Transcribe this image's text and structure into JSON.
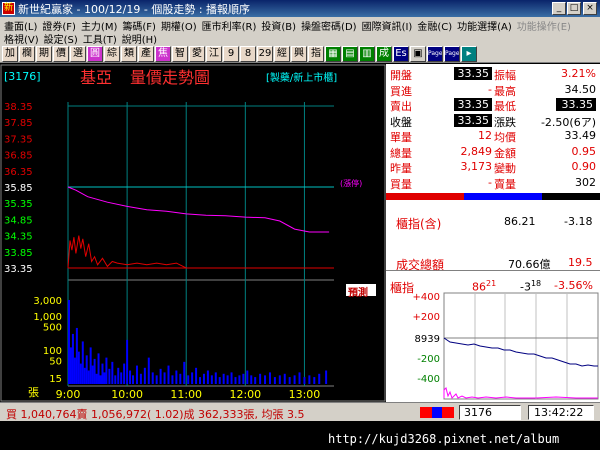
{
  "window": {
    "title": "新世紀贏家 - 100/12/19 - 個股走勢 : 播報順序",
    "app_icon": "app-icon",
    "buttons": {
      "min": "_",
      "max": "□",
      "close": "×"
    }
  },
  "menu": {
    "row1": [
      "畫面(L)",
      "證券(F)",
      "主力(M)",
      "籌碼(F)",
      "期權(O)",
      "匯市利率(R)",
      "投資(B)",
      "操盤密碼(D)",
      "國際資訊(I)",
      "金融(C)",
      "功能選擇(A)",
      "功能操作(E)"
    ],
    "row2": [
      "格視(V)",
      "設定(S)",
      "工具(T)",
      "說明(H)"
    ]
  },
  "toolbar": {
    "items": [
      {
        "label": "加",
        "bg": "#e8d8c8",
        "fg": "#000"
      },
      {
        "label": "欄",
        "bg": "#e8d8c8",
        "fg": "#000"
      },
      {
        "label": "期",
        "bg": "#e8d8c8",
        "fg": "#000"
      },
      {
        "label": "價",
        "bg": "#e8d8c8",
        "fg": "#000"
      },
      {
        "label": "選",
        "bg": "#e8d8c8",
        "fg": "#000"
      },
      {
        "label": "圓",
        "bg": "#cc33cc",
        "fg": "#fff"
      },
      {
        "label": "綜",
        "bg": "#e8d8c8",
        "fg": "#000"
      },
      {
        "label": "類",
        "bg": "#e8d8c8",
        "fg": "#000"
      },
      {
        "label": "產",
        "bg": "#e8d8c8",
        "fg": "#000"
      },
      {
        "label": "焦",
        "bg": "#cc33cc",
        "fg": "#fff"
      },
      {
        "label": "智",
        "bg": "#e8d8c8",
        "fg": "#000"
      },
      {
        "label": "愛",
        "bg": "#e8d8c8",
        "fg": "#000"
      },
      {
        "label": "江",
        "bg": "#e8d8c8",
        "fg": "#000"
      },
      {
        "label": "9",
        "bg": "#e8d8c8",
        "fg": "#000"
      },
      {
        "label": "8",
        "bg": "#e8d8c8",
        "fg": "#000"
      },
      {
        "label": "29",
        "bg": "#e8d8c8",
        "fg": "#000"
      },
      {
        "label": "經",
        "bg": "#e8d8c8",
        "fg": "#000"
      },
      {
        "label": "興",
        "bg": "#e8d8c8",
        "fg": "#000"
      },
      {
        "label": "指",
        "bg": "#e8d8c8",
        "fg": "#000"
      },
      {
        "label": "▦",
        "bg": "#008000",
        "fg": "#fff"
      },
      {
        "label": "▤",
        "bg": "#008000",
        "fg": "#fff"
      },
      {
        "label": "▥",
        "bg": "#008000",
        "fg": "#fff"
      },
      {
        "label": "成",
        "bg": "#008000",
        "fg": "#fff"
      },
      {
        "label": "Es",
        "bg": "#000080",
        "fg": "#fff"
      },
      {
        "label": "▣",
        "bg": "#d4d0c8",
        "fg": "#000"
      },
      {
        "label": "Page",
        "bg": "#000080",
        "fg": "#fff"
      },
      {
        "label": "Page",
        "bg": "#000080",
        "fg": "#fff"
      },
      {
        "label": "▸",
        "bg": "#008080",
        "fg": "#fff"
      }
    ]
  },
  "chart": {
    "code": "[3176]",
    "name": "基亞",
    "view_title": "量價走勢圖",
    "market": "[製藥/新上市櫃]",
    "limit_up_tag": "(漲停)",
    "limit_down_tag": "預測",
    "unit_label": "張",
    "chart_data": {
      "type": "line",
      "price_ticks": [
        "38.35",
        "37.85",
        "37.35",
        "36.85",
        "36.35",
        "35.85",
        "35.35",
        "34.85",
        "34.35",
        "33.85",
        "33.35"
      ],
      "price_range": [
        33.35,
        38.35
      ],
      "reference_price": 35.85,
      "low_line": 33.35,
      "volume_ticks": [
        "3,000",
        "1,000",
        "500",
        "100",
        "50",
        "15"
      ],
      "time_ticks": [
        "9:00",
        "10:00",
        "11:00",
        "12:00",
        "13:00"
      ],
      "avg_series": [
        {
          "t": 0,
          "p": 35.85
        },
        {
          "t": 8,
          "p": 35.75
        },
        {
          "t": 20,
          "p": 35.55
        },
        {
          "t": 40,
          "p": 35.38
        },
        {
          "t": 60,
          "p": 35.25
        },
        {
          "t": 80,
          "p": 35.15
        },
        {
          "t": 100,
          "p": 35.1
        },
        {
          "t": 120,
          "p": 35.02
        },
        {
          "t": 140,
          "p": 34.98
        },
        {
          "t": 160,
          "p": 34.96
        },
        {
          "t": 180,
          "p": 34.92
        },
        {
          "t": 200,
          "p": 34.9
        },
        {
          "t": 215,
          "p": 34.8
        },
        {
          "t": 230,
          "p": 34.55
        },
        {
          "t": 245,
          "p": 34.46
        },
        {
          "t": 265,
          "p": 34.46
        }
      ],
      "price_series": [
        {
          "t": 0,
          "p": 33.35
        },
        {
          "t": 2,
          "p": 34.2
        },
        {
          "t": 4,
          "p": 33.9
        },
        {
          "t": 6,
          "p": 34.3
        },
        {
          "t": 8,
          "p": 33.8
        },
        {
          "t": 11,
          "p": 34.35
        },
        {
          "t": 13,
          "p": 33.95
        },
        {
          "t": 15,
          "p": 34.25
        },
        {
          "t": 18,
          "p": 33.7
        },
        {
          "t": 21,
          "p": 34.1
        },
        {
          "t": 24,
          "p": 33.55
        },
        {
          "t": 27,
          "p": 33.7
        },
        {
          "t": 30,
          "p": 33.45
        },
        {
          "t": 35,
          "p": 33.65
        },
        {
          "t": 40,
          "p": 33.4
        },
        {
          "t": 45,
          "p": 33.55
        },
        {
          "t": 50,
          "p": 33.5
        },
        {
          "t": 60,
          "p": 33.45
        },
        {
          "t": 70,
          "p": 33.5
        },
        {
          "t": 80,
          "p": 33.45
        },
        {
          "t": 90,
          "p": 33.5
        },
        {
          "t": 100,
          "p": 33.45
        },
        {
          "t": 110,
          "p": 33.5
        },
        {
          "t": 120,
          "p": 33.35
        },
        {
          "t": 140,
          "p": 33.35
        },
        {
          "t": 160,
          "p": 33.35
        },
        {
          "t": 185,
          "p": 33.35
        }
      ],
      "volume_series": [
        {
          "t": 1,
          "v": 3000
        },
        {
          "t": 3,
          "v": 120
        },
        {
          "t": 5,
          "v": 300
        },
        {
          "t": 7,
          "v": 60
        },
        {
          "t": 9,
          "v": 450
        },
        {
          "t": 11,
          "v": 90
        },
        {
          "t": 13,
          "v": 40
        },
        {
          "t": 15,
          "v": 180
        },
        {
          "t": 17,
          "v": 30
        },
        {
          "t": 19,
          "v": 70
        },
        {
          "t": 21,
          "v": 25
        },
        {
          "t": 23,
          "v": 120
        },
        {
          "t": 25,
          "v": 35
        },
        {
          "t": 27,
          "v": 55
        },
        {
          "t": 29,
          "v": 20
        },
        {
          "t": 31,
          "v": 80
        },
        {
          "t": 33,
          "v": 18
        },
        {
          "t": 35,
          "v": 40
        },
        {
          "t": 37,
          "v": 22
        },
        {
          "t": 39,
          "v": 60
        },
        {
          "t": 42,
          "v": 28
        },
        {
          "t": 45,
          "v": 45
        },
        {
          "t": 48,
          "v": 18
        },
        {
          "t": 51,
          "v": 30
        },
        {
          "t": 54,
          "v": 22
        },
        {
          "t": 57,
          "v": 40
        },
        {
          "t": 60,
          "v": 200
        },
        {
          "t": 63,
          "v": 25
        },
        {
          "t": 66,
          "v": 18
        },
        {
          "t": 70,
          "v": 35
        },
        {
          "t": 74,
          "v": 20
        },
        {
          "t": 78,
          "v": 30
        },
        {
          "t": 82,
          "v": 60
        },
        {
          "t": 86,
          "v": 22
        },
        {
          "t": 90,
          "v": 18
        },
        {
          "t": 94,
          "v": 28
        },
        {
          "t": 98,
          "v": 22
        },
        {
          "t": 102,
          "v": 35
        },
        {
          "t": 106,
          "v": 18
        },
        {
          "t": 110,
          "v": 25
        },
        {
          "t": 114,
          "v": 20
        },
        {
          "t": 118,
          "v": 45
        },
        {
          "t": 122,
          "v": 18
        },
        {
          "t": 126,
          "v": 22
        },
        {
          "t": 130,
          "v": 30
        },
        {
          "t": 134,
          "v": 16
        },
        {
          "t": 138,
          "v": 20
        },
        {
          "t": 142,
          "v": 25
        },
        {
          "t": 146,
          "v": 18
        },
        {
          "t": 150,
          "v": 22
        },
        {
          "t": 154,
          "v": 16
        },
        {
          "t": 158,
          "v": 20
        },
        {
          "t": 162,
          "v": 18
        },
        {
          "t": 166,
          "v": 22
        },
        {
          "t": 170,
          "v": 16
        },
        {
          "t": 174,
          "v": 18
        },
        {
          "t": 178,
          "v": 20
        },
        {
          "t": 182,
          "v": 25
        },
        {
          "t": 186,
          "v": 18
        },
        {
          "t": 190,
          "v": 16
        },
        {
          "t": 195,
          "v": 20
        },
        {
          "t": 200,
          "v": 18
        },
        {
          "t": 205,
          "v": 22
        },
        {
          "t": 210,
          "v": 16
        },
        {
          "t": 215,
          "v": 18
        },
        {
          "t": 220,
          "v": 20
        },
        {
          "t": 225,
          "v": 16
        },
        {
          "t": 230,
          "v": 18
        },
        {
          "t": 235,
          "v": 22
        },
        {
          "t": 240,
          "v": 16
        },
        {
          "t": 245,
          "v": 18
        },
        {
          "t": 250,
          "v": 16
        },
        {
          "t": 255,
          "v": 20
        },
        {
          "t": 262,
          "v": 25
        }
      ],
      "colors": {
        "grid": "#008080",
        "price": "#e00000",
        "avg": "#ff00ff",
        "volume": "#0000ff",
        "ref": "#00c0c0",
        "axis_text": "#00ffff",
        "time_text": "#ffff00"
      }
    }
  },
  "quote": {
    "rows": [
      {
        "l1": "開盤",
        "v1": "33.35",
        "l2": "振幅",
        "v2": "3.21%",
        "c1": "#e00000",
        "c2": "#e00000",
        "box1": true
      },
      {
        "l1": "買進",
        "v1": "-",
        "l2": "最高",
        "v2": "34.50",
        "c1": "#e00000",
        "c2": "#000000",
        "box1": false
      },
      {
        "l1": "賣出",
        "v1": "33.35",
        "l2": "最低",
        "v2": "33.35",
        "c1": "#e00000",
        "c2": "#e00000",
        "box1": true,
        "box2": true
      },
      {
        "l1": "收盤",
        "v1": "33.35",
        "l2": "漲跌",
        "v2": "-2.50(6ア)",
        "c1": "#000000",
        "c2": "#000000",
        "box1": true
      },
      {
        "l1": "單量",
        "v1": "12",
        "l2": "均價",
        "v2": "33.49",
        "c1": "#e00000",
        "c2": "#000000"
      },
      {
        "l1": "總量",
        "v1": "2,849",
        "l2": "金額",
        "v2": "0.95",
        "c1": "#e00000",
        "c2": "#e00000"
      },
      {
        "l1": "昨量",
        "v1": "3,173",
        "l2": "變動",
        "v2": "0.90",
        "c1": "#e00000",
        "c2": "#e00000"
      },
      {
        "l1": "買量",
        "v1": "-",
        "l2": "賣量",
        "v2": "302",
        "c1": "#e00000",
        "c2": "#000000"
      }
    ],
    "index_label": "櫃指(含)",
    "index_value": "86.21",
    "index_change": "-3.18",
    "turnover_label": "成交總額",
    "turnover_value": "70.66億",
    "turnover_change": "19.5"
  },
  "mini": {
    "label": "櫃指",
    "value_big": "86",
    "value_small": "21",
    "change_big": "-3",
    "change_small": "18",
    "pct": "-3.56%",
    "ticks": [
      "+400",
      "+200",
      "8939",
      "-200",
      "-400"
    ]
  },
  "status": {
    "text": "買 1,040,764賣 1,056,972( 1.02)成 362,333張, 均張 3.5",
    "code_input": "3176",
    "clock": "13:42:22"
  },
  "footer": {
    "url": "http://kujd3268.pixnet.net/album"
  }
}
